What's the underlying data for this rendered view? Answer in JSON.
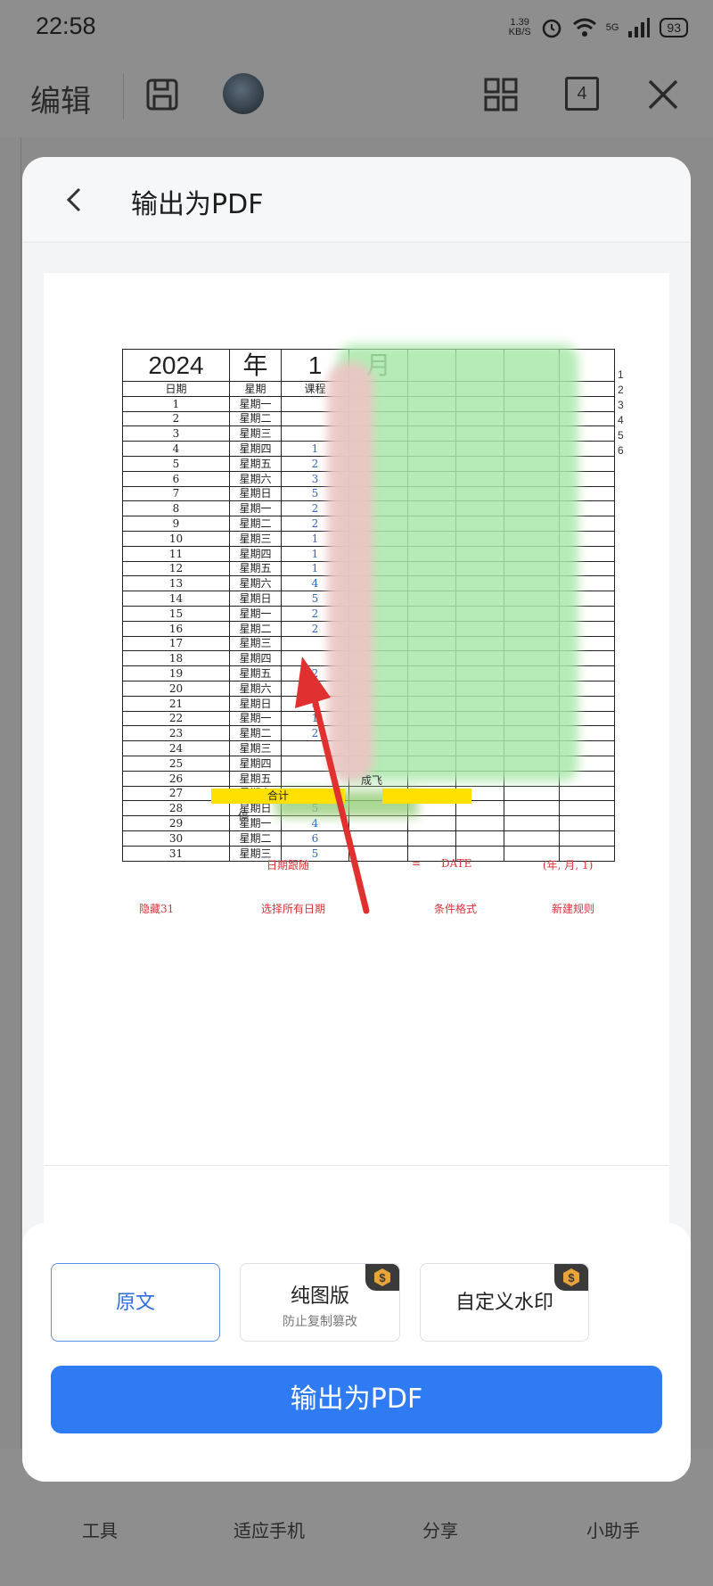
{
  "status_bar": {
    "time": "22:58",
    "net_speed_value": "1.39",
    "net_speed_unit": "KB/S",
    "signal": "5G",
    "battery": "93"
  },
  "background_toolbar": {
    "edit_label": "编辑",
    "page_count": "4"
  },
  "background_bottom_nav": [
    {
      "label": "工具"
    },
    {
      "label": "适应手机"
    },
    {
      "label": "分享"
    },
    {
      "label": "小助手"
    }
  ],
  "modal": {
    "title": "输出为PDF"
  },
  "preview": {
    "header": {
      "year": "2024",
      "year_unit": "年",
      "month": "1",
      "month_unit": "月"
    },
    "subheader": {
      "date": "日期",
      "weekday": "星期",
      "course": "课程"
    },
    "rows": [
      {
        "d": "1",
        "w": "星期一",
        "c": ""
      },
      {
        "d": "2",
        "w": "星期二",
        "c": ""
      },
      {
        "d": "3",
        "w": "星期三",
        "c": ""
      },
      {
        "d": "4",
        "w": "星期四",
        "c": "1"
      },
      {
        "d": "5",
        "w": "星期五",
        "c": "2"
      },
      {
        "d": "6",
        "w": "星期六",
        "c": "3"
      },
      {
        "d": "7",
        "w": "星期日",
        "c": "5"
      },
      {
        "d": "8",
        "w": "星期一",
        "c": "2"
      },
      {
        "d": "9",
        "w": "星期二",
        "c": "2"
      },
      {
        "d": "10",
        "w": "星期三",
        "c": "1"
      },
      {
        "d": "11",
        "w": "星期四",
        "c": "1"
      },
      {
        "d": "12",
        "w": "星期五",
        "c": "1"
      },
      {
        "d": "13",
        "w": "星期六",
        "c": "4"
      },
      {
        "d": "14",
        "w": "星期日",
        "c": "5"
      },
      {
        "d": "15",
        "w": "星期一",
        "c": "2"
      },
      {
        "d": "16",
        "w": "星期二",
        "c": "2"
      },
      {
        "d": "17",
        "w": "星期三",
        "c": ""
      },
      {
        "d": "18",
        "w": "星期四",
        "c": ""
      },
      {
        "d": "19",
        "w": "星期五",
        "c": "2"
      },
      {
        "d": "20",
        "w": "星期六",
        "c": "5"
      },
      {
        "d": "21",
        "w": "星期日",
        "c": "5"
      },
      {
        "d": "22",
        "w": "星期一",
        "c": "1"
      },
      {
        "d": "23",
        "w": "星期二",
        "c": "2"
      },
      {
        "d": "24",
        "w": "星期三",
        "c": ""
      },
      {
        "d": "25",
        "w": "星期四",
        "c": ""
      },
      {
        "d": "26",
        "w": "星期五",
        "c": ""
      },
      {
        "d": "27",
        "w": "星期六",
        "c": "4"
      },
      {
        "d": "28",
        "w": "星期日",
        "c": "5"
      },
      {
        "d": "29",
        "w": "星期一",
        "c": "4"
      },
      {
        "d": "30",
        "w": "星期二",
        "c": "6"
      },
      {
        "d": "31",
        "w": "星期三",
        "c": "5"
      }
    ],
    "total_label": "合计",
    "stop_label": "停",
    "cheng_label": "成飞",
    "side_numbers": [
      "1",
      "2",
      "3",
      "4",
      "5",
      "6"
    ],
    "notes_row1": [
      "日期跟随",
      "=",
      "DATE",
      "(年, 月, 1)"
    ],
    "notes_row2": [
      "隐藏31",
      "选择所有日期",
      "条件格式",
      "新建规则"
    ]
  },
  "options": {
    "original": {
      "label": "原文"
    },
    "image_only": {
      "label": "纯图版",
      "sub": "防止复制篡改"
    },
    "watermark": {
      "label": "自定义水印"
    }
  },
  "export_button": "输出为PDF",
  "colors": {
    "accent": "#2f7bf4",
    "badge": "#e8a33a",
    "note_red": "#d8333a",
    "highlight": "#ffe000"
  }
}
